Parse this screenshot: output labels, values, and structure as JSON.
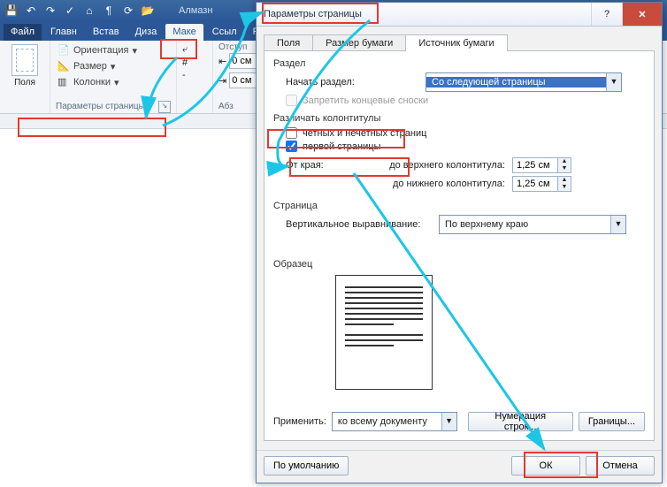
{
  "qat_title": "Алмазн",
  "tabs": {
    "file": "Файл",
    "home": "Главн",
    "insert": "Встав",
    "design": "Диза",
    "layout": "Маке",
    "refs": "Ссыл",
    "review": "Рас"
  },
  "ribbon": {
    "polya_label": "Поля",
    "orientation": "Ориентация",
    "size": "Размер",
    "columns": "Колонки",
    "page_setup_label": "Параметры страницы",
    "indent_label": "Отступ",
    "indent_left": "0 см",
    "indent_right": "0 см",
    "paragraph_label": "Абз"
  },
  "dialog": {
    "title": "Параметры страницы",
    "tabs": {
      "margins": "Поля",
      "paper": "Размер бумаги",
      "source": "Источник бумаги"
    },
    "section": {
      "label": "Раздел",
      "start_label": "Начать раздел:",
      "start_value": "Со следующей страницы",
      "suppress": "Запретить концевые сноски"
    },
    "headers": {
      "label": "Различать колонтитулы",
      "odd_even": "четных и нечетных страниц",
      "first": "первой страницы",
      "from_edge": "От края:",
      "top": "до верхнего колонтитула:",
      "top_val": "1,25 см",
      "bottom": "до нижнего колонтитула:",
      "bottom_val": "1,25 см"
    },
    "page": {
      "label": "Страница",
      "valign_label": "Вертикальное выравнивание:",
      "valign_value": "По верхнему краю"
    },
    "preview_label": "Образец",
    "apply_label": "Применить:",
    "apply_value": "ко всему документу",
    "line_numbers": "Нумерация строк...",
    "borders": "Границы...",
    "default": "По умолчанию",
    "ok": "ОК",
    "cancel": "Отмена"
  }
}
